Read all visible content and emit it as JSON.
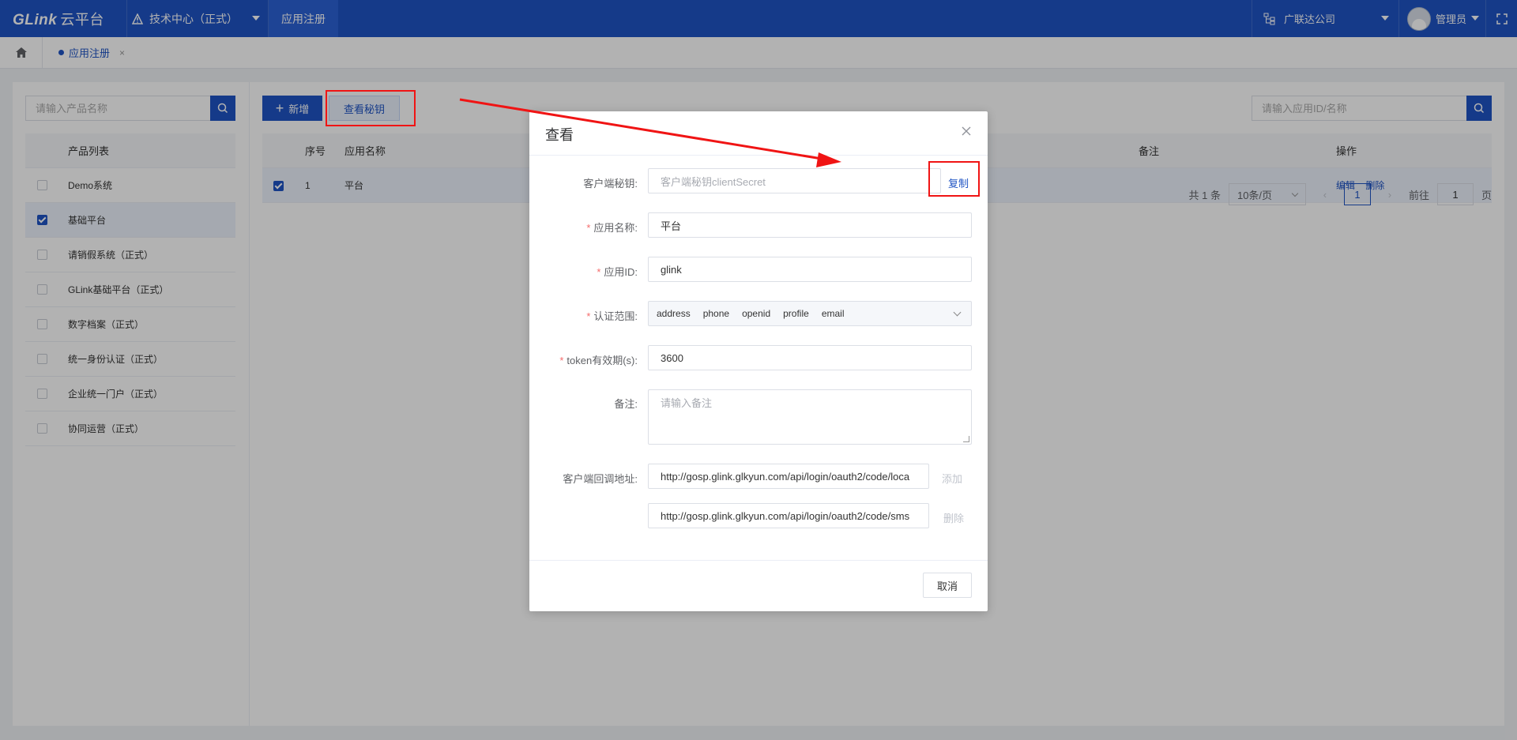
{
  "topbar": {
    "logo": "GLink",
    "logo_suffix": "云平台",
    "department": "技术中心（正式）",
    "nav_item": "应用注册",
    "org": "广联达公司",
    "user": "管理员"
  },
  "tabs": {
    "active_tab": "应用注册",
    "close": "×"
  },
  "left": {
    "search_placeholder": "请输入产品名称",
    "list_header": "产品列表",
    "products": [
      {
        "label": "Demo系统",
        "checked": false
      },
      {
        "label": "基础平台",
        "checked": true
      },
      {
        "label": "请销假系统（正式）",
        "checked": false
      },
      {
        "label": "GLink基础平台（正式）",
        "checked": false
      },
      {
        "label": "数字档案（正式）",
        "checked": false
      },
      {
        "label": "统一身份认证（正式）",
        "checked": false
      },
      {
        "label": "企业统一门户（正式）",
        "checked": false
      },
      {
        "label": "协同运营（正式）",
        "checked": false
      }
    ]
  },
  "main": {
    "add_button": "新增",
    "add_icon": "+",
    "view_secret_button": "查看秘钥",
    "search_placeholder": "请输入应用ID/名称",
    "columns": {
      "no": "序号",
      "name": "应用名称",
      "remark": "备注",
      "op": "操作"
    },
    "rows": [
      {
        "no": "1",
        "name": "平台",
        "edit": "编辑",
        "delete": "删除"
      }
    ],
    "pager": {
      "total": "共 1 条",
      "page_size": "10条/页",
      "prev": "‹",
      "current": "1",
      "next": "›",
      "goto_label": "前往",
      "goto_value": "1",
      "page_unit": "页"
    }
  },
  "dialog": {
    "title": "查看",
    "client_secret_label": "客户端秘钥:",
    "client_secret_placeholder": "客户端秘钥clientSecret",
    "copy": "复制",
    "app_name_label": "应用名称:",
    "app_name_value": "平台",
    "app_id_label": "应用ID:",
    "app_id_value": "glink",
    "scope_label": "认证范围:",
    "scopes": [
      "address",
      "phone",
      "openid",
      "profile",
      "email"
    ],
    "token_label": "token有效期(s):",
    "token_value": "3600",
    "remark_label": "备注:",
    "remark_placeholder": "请输入备注",
    "redirect_label": "客户端回调地址:",
    "redirect_urls": [
      "http://gosp.glink.glkyun.com/api/login/oauth2/code/loca",
      "http://gosp.glink.glkyun.com/api/login/oauth2/code/sms"
    ],
    "add_link": "添加",
    "delete_link": "删除",
    "cancel": "取消"
  },
  "colors": {
    "primary": "#1f54c4",
    "annotation": "#f01414"
  }
}
